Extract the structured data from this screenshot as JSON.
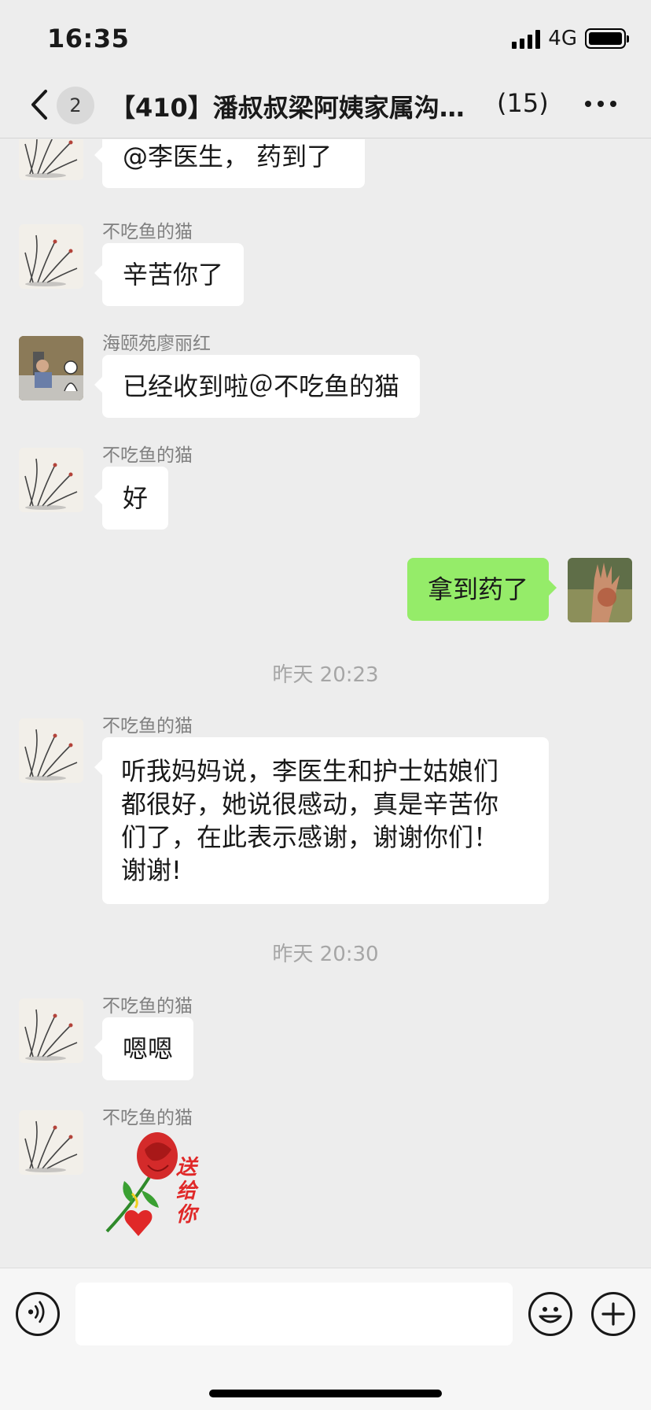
{
  "status_bar": {
    "time": "16:35",
    "network": "4G"
  },
  "nav": {
    "unread_count": "2",
    "title": "【410】潘叔叔梁阿姨家属沟…",
    "member_count": "(15)"
  },
  "messages": [
    {
      "text": "@李医生， 药到了"
    },
    {
      "sender": "不吃鱼的猫",
      "text": "辛苦你了"
    },
    {
      "sender": "海颐苑廖丽红",
      "text": "已经收到啦＠不吃鱼的猫"
    },
    {
      "sender": "不吃鱼的猫",
      "text": "好"
    },
    {
      "text": "拿到药了"
    },
    {
      "sender": "不吃鱼的猫",
      "lines": [
        "听我妈妈说，李医生和护士姑娘们",
        "都很好，她说很感动，真是辛苦你",
        "们了，在此表示感谢，谢谢你们！",
        "谢谢!"
      ]
    },
    {
      "sender": "不吃鱼的猫",
      "text": "嗯嗯"
    },
    {
      "sender": "不吃鱼的猫",
      "sticker_text": "送给你"
    }
  ],
  "timestamps": [
    "昨天 20:23",
    "昨天 20:30"
  ],
  "colors": {
    "background": "#ededed",
    "my_bubble": "#95ec69",
    "other_bubble": "#ffffff",
    "rose": "#d42a2a"
  },
  "icons": [
    "back-icon",
    "more-icon",
    "voice-icon",
    "emoji-icon",
    "plus-icon"
  ]
}
